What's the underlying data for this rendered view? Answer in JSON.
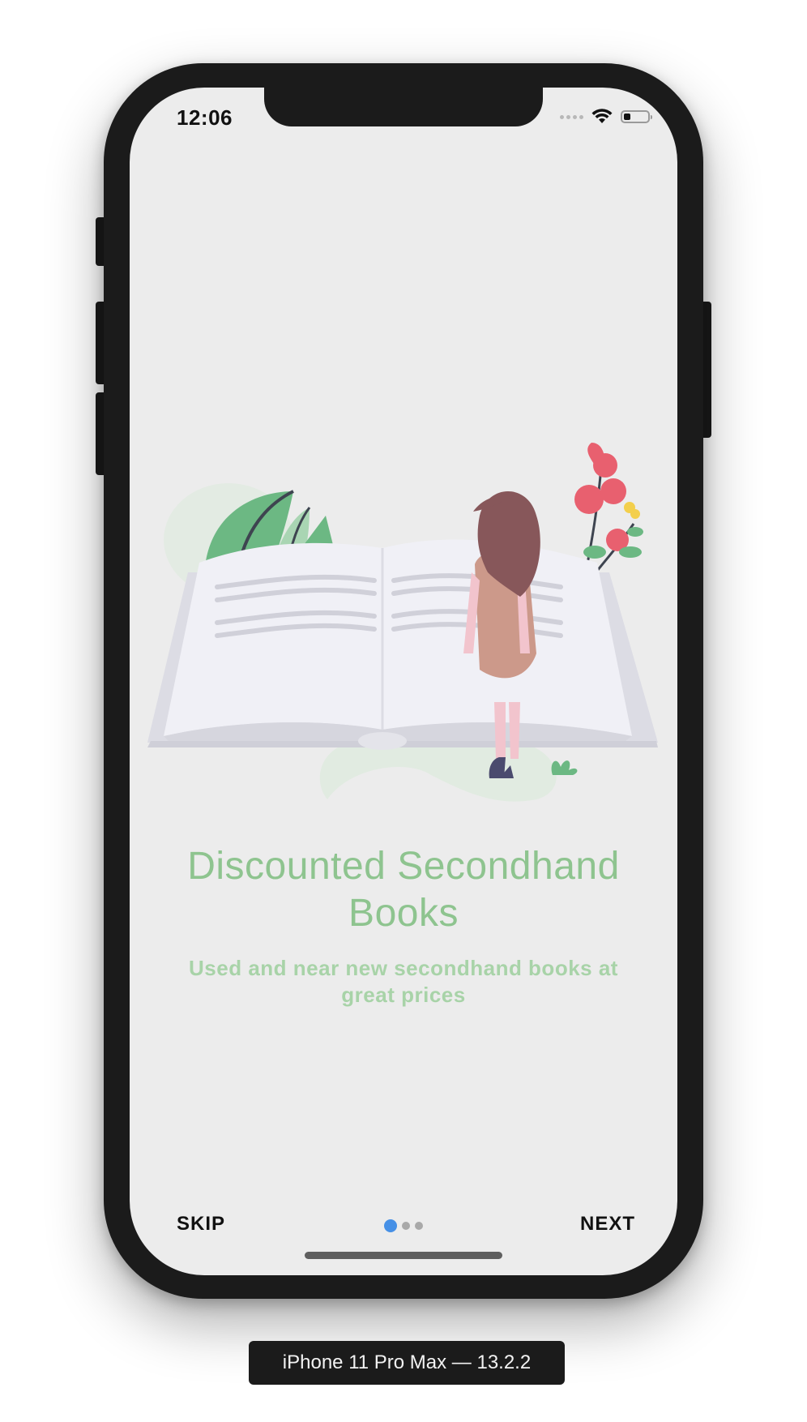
{
  "status_bar": {
    "time": "12:06",
    "icons": [
      "cellular-signal-icon",
      "wifi-icon",
      "battery-icon"
    ],
    "battery_fraction": 0.3
  },
  "onboarding": {
    "title": "Discounted Secondhand Books",
    "subtitle": "Used and near new secondhand books at great prices",
    "skip_label": "SKIP",
    "next_label": "NEXT",
    "page_indicator": {
      "total": 3,
      "current": 1
    }
  },
  "device": {
    "label": "iPhone 11 Pro Max — 13.2.2"
  },
  "colors": {
    "title": "#8ec48f",
    "subtitle": "#a8d3a8",
    "active_dot": "#4690e6",
    "inactive_dot": "#a9a9a9",
    "screen_background": "#ececec",
    "device_frame": "#1b1b1b"
  }
}
